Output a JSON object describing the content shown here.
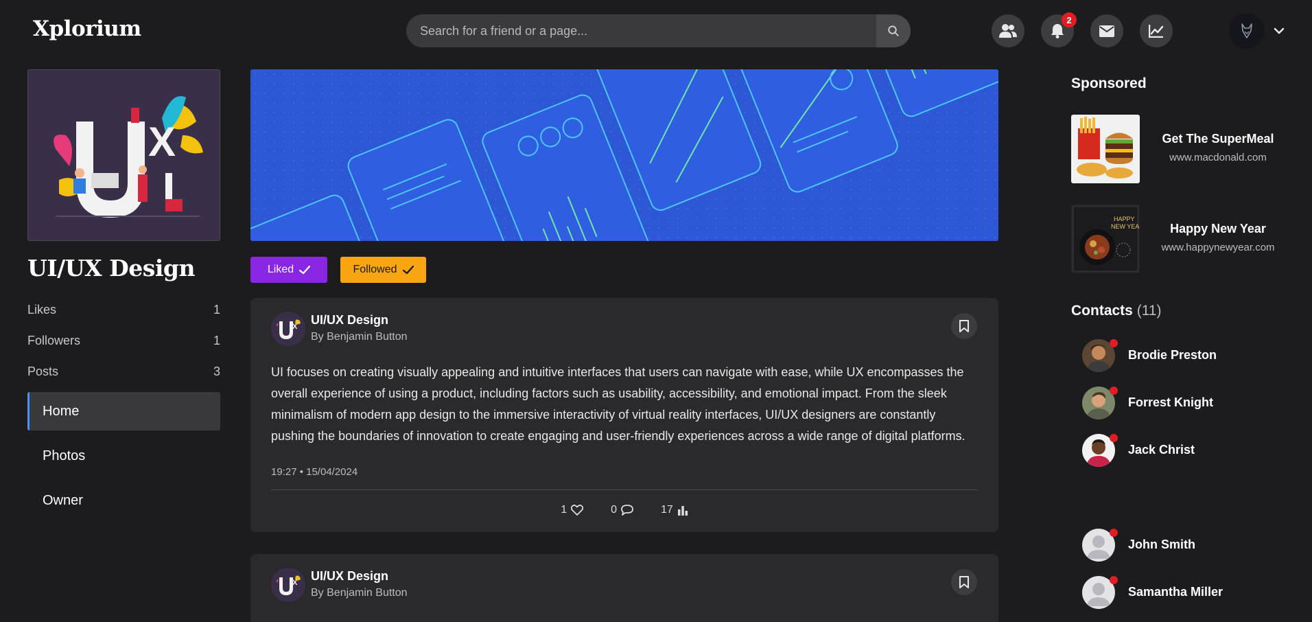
{
  "app": {
    "logo": "Xplorium"
  },
  "search": {
    "placeholder": "Search for a friend or a page..."
  },
  "nav": {
    "notification_count": "2",
    "icons": [
      "friends-icon",
      "bell-icon",
      "mail-icon",
      "chart-icon"
    ]
  },
  "page": {
    "title": "UI/UX Design",
    "stats": [
      {
        "label": "Likes",
        "value": "1"
      },
      {
        "label": "Followers",
        "value": "1"
      },
      {
        "label": "Posts",
        "value": "3"
      }
    ],
    "menu": [
      {
        "label": "Home",
        "active": true
      },
      {
        "label": "Photos",
        "active": false
      },
      {
        "label": "Owner",
        "active": false
      }
    ],
    "liked_label": "Liked",
    "followed_label": "Followed"
  },
  "posts": [
    {
      "author": "UI/UX Design",
      "by": "By Benjamin Button",
      "text": "UI focuses on creating visually appealing and intuitive interfaces that users can navigate with ease, while UX encompasses the overall experience of using a product, including factors such as usability, accessibility, and emotional impact. From the sleek minimalism of modern app design to the immersive interactivity of virtual reality interfaces, UI/UX designers are constantly pushing the boundaries of innovation to create engaging and user-friendly experiences across a wide range of digital platforms.",
      "datetime": "19:27 • 15/04/2024",
      "likes": "1",
      "comments": "0",
      "views": "17"
    },
    {
      "author": "UI/UX Design",
      "by": "By Benjamin Button"
    }
  ],
  "sponsored": {
    "title": "Sponsored",
    "ads": [
      {
        "title": "Get The SuperMeal",
        "url": "www.macdonald.com"
      },
      {
        "title": "Happy New Year",
        "url": "www.happynewyear.com"
      }
    ]
  },
  "contacts": {
    "title": "Contacts",
    "count": "(11)",
    "items": [
      {
        "name": "Brodie Preston"
      },
      {
        "name": "Forrest Knight"
      },
      {
        "name": "Jack Christ"
      },
      {
        "name": "John Smith"
      },
      {
        "name": "Samantha Miller"
      }
    ]
  },
  "colors": {
    "liked": "#8a26e3",
    "followed": "#f9a612",
    "active_indicator": "#4d8ef7",
    "online_dot": "#e11d24"
  }
}
